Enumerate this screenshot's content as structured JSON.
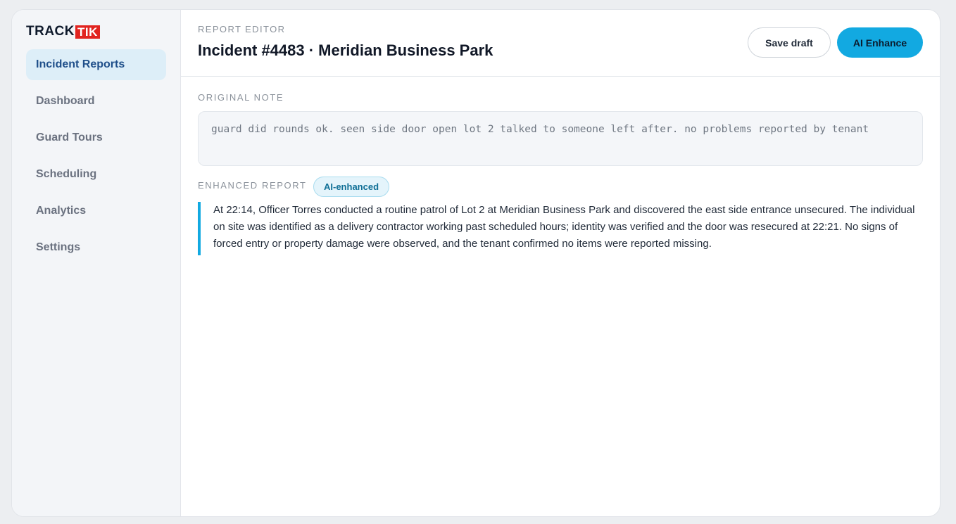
{
  "brand": {
    "part1": "TRACK",
    "part2": "TIK",
    "accent_color": "#e1231f"
  },
  "sidebar": {
    "items": [
      {
        "label": "Incident Reports",
        "active": true
      },
      {
        "label": "Dashboard",
        "active": false
      },
      {
        "label": "Guard Tours",
        "active": false
      },
      {
        "label": "Scheduling",
        "active": false
      },
      {
        "label": "Analytics",
        "active": false
      },
      {
        "label": "Settings",
        "active": false
      }
    ]
  },
  "header": {
    "eyebrow": "REPORT EDITOR",
    "title": "Incident #4483 · Meridian Business Park",
    "save_label": "Save draft",
    "enhance_label": "AI Enhance",
    "enhance_color": "#12a9e1"
  },
  "original_note": {
    "label": "ORIGINAL NOTE",
    "text": "guard did rounds ok. seen side door open lot 2 talked to someone left after. no problems reported by tenant"
  },
  "enhanced_report": {
    "label": "ENHANCED REPORT",
    "badge": "AI-enhanced",
    "text": "At 22:14, Officer Torres conducted a routine patrol of Lot 2 at Meridian Business Park and discovered the east side entrance unsecured. The individual on site was identified as a delivery contractor working past scheduled hours; identity was verified and the door was resecured at 22:21. No signs of forced entry or property damage were observed, and the tenant confirmed no items were reported missing."
  }
}
